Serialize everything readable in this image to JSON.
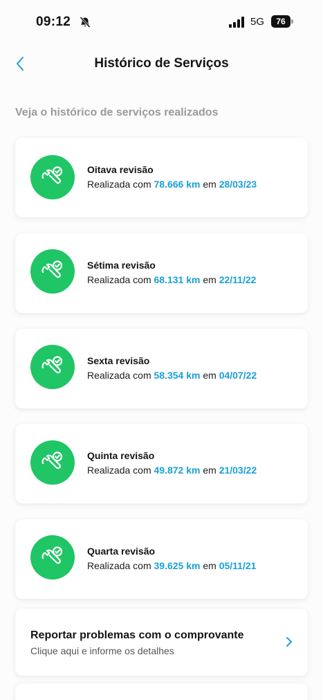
{
  "status_bar": {
    "time": "09:12",
    "network": "5G",
    "battery": "76",
    "icons": [
      "bell-slash-icon",
      "signal-bars-icon",
      "battery-icon"
    ]
  },
  "header": {
    "title": "Histórico de Serviços",
    "back_icon": "chevron-left-icon"
  },
  "subtitle": "Veja o histórico de serviços realizados",
  "colors": {
    "accent": "#1aa0d8",
    "icon_green": "#20c565",
    "subtitle_gray": "#9a9a9a"
  },
  "services": [
    {
      "title": "Oitava revisão",
      "prefix": "Realizada com ",
      "km": "78.666 km",
      "mid": " em ",
      "date": "28/03/23",
      "icon": "wrench-check-icon"
    },
    {
      "title": "Sétima revisão",
      "prefix": "Realizada com ",
      "km": "68.131 km",
      "mid": " em ",
      "date": "22/11/22",
      "icon": "wrench-check-icon"
    },
    {
      "title": "Sexta revisão",
      "prefix": "Realizada com ",
      "km": "58.354 km",
      "mid": " em ",
      "date": "04/07/22",
      "icon": "wrench-check-icon"
    },
    {
      "title": "Quinta revisão",
      "prefix": "Realizada com ",
      "km": "49.872 km",
      "mid": " em ",
      "date": "21/03/22",
      "icon": "wrench-check-icon"
    },
    {
      "title": "Quarta revisão",
      "prefix": "Realizada com ",
      "km": "39.625 km",
      "mid": " em ",
      "date": "05/11/21",
      "icon": "wrench-check-icon"
    }
  ],
  "report": {
    "title": "Reportar problemas com o comprovante",
    "subtitle": "Clique aqui e informe os detalhes",
    "icon": "chevron-right-icon"
  }
}
